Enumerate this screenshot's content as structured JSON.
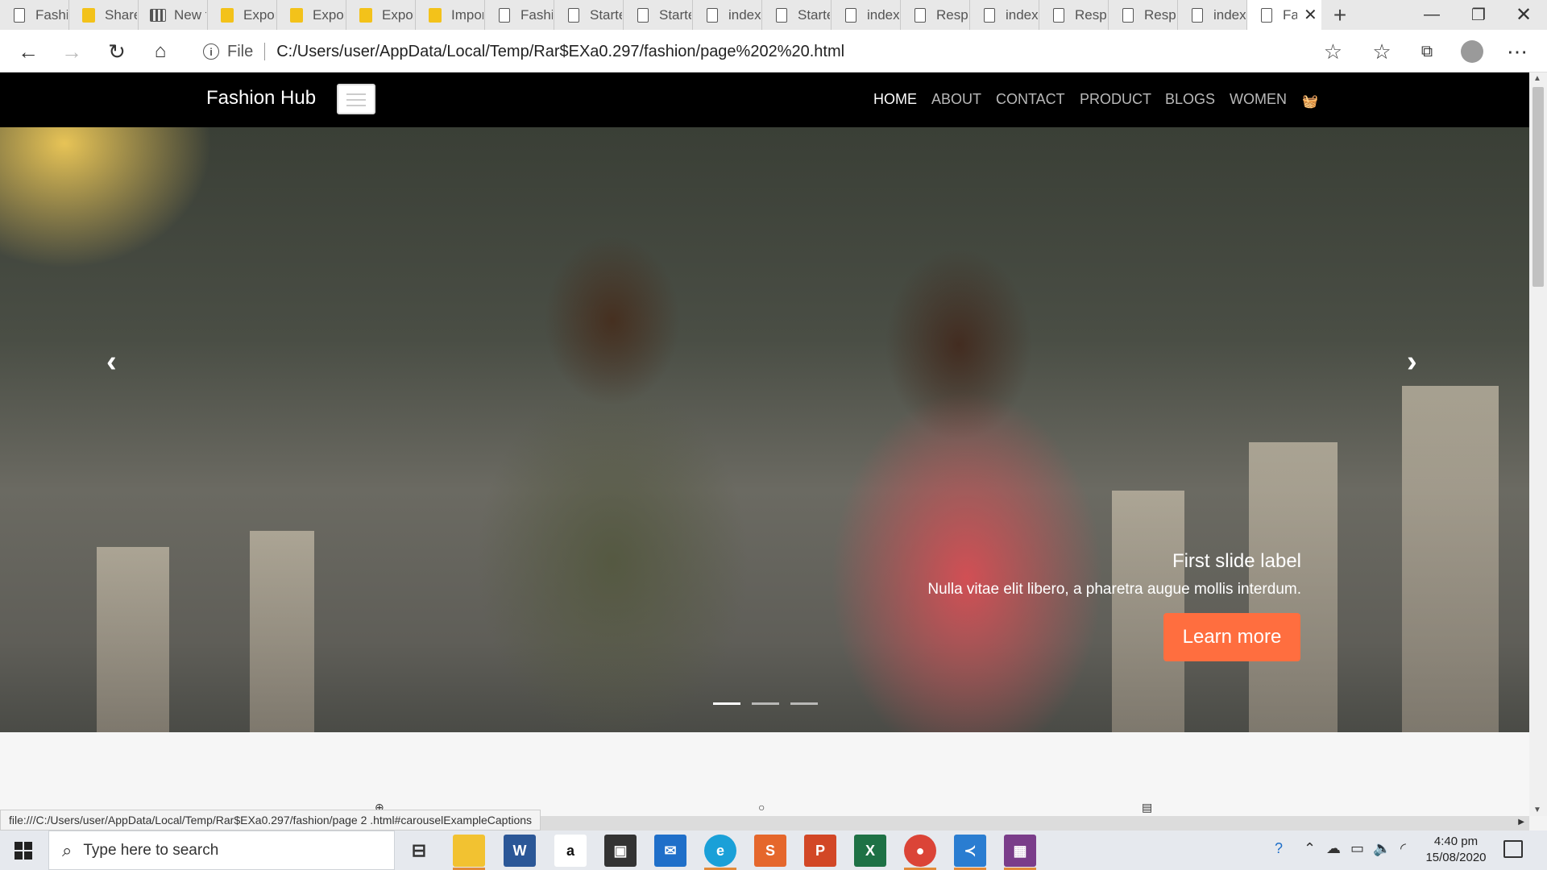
{
  "browser": {
    "tabs": [
      {
        "label": "Fashio",
        "icon": "page-icon"
      },
      {
        "label": "Share",
        "icon": "folder-icon"
      },
      {
        "label": "New t",
        "icon": "grid-icon"
      },
      {
        "label": "Expor",
        "icon": "folder-icon"
      },
      {
        "label": "Expor",
        "icon": "folder-icon"
      },
      {
        "label": "Expor",
        "icon": "folder-icon"
      },
      {
        "label": "Impor",
        "icon": "folder-icon"
      },
      {
        "label": "Fashio",
        "icon": "page-icon"
      },
      {
        "label": "Starte",
        "icon": "page-icon"
      },
      {
        "label": "Starte",
        "icon": "page-icon"
      },
      {
        "label": "index",
        "icon": "page-icon"
      },
      {
        "label": "Starte",
        "icon": "page-icon"
      },
      {
        "label": "index",
        "icon": "page-icon"
      },
      {
        "label": "Respo",
        "icon": "page-icon"
      },
      {
        "label": "index",
        "icon": "page-icon"
      },
      {
        "label": "Respo",
        "icon": "page-icon"
      },
      {
        "label": "Respo",
        "icon": "page-icon"
      },
      {
        "label": "index",
        "icon": "page-icon"
      }
    ],
    "active_tab": {
      "label": "Fa",
      "icon": "page-icon",
      "close": "✕"
    },
    "new_tab": "+",
    "address": {
      "scheme": "File",
      "url": "C:/Users/user/AppData/Local/Temp/Rar$EXa0.297/fashion/page%202%20.html"
    },
    "status_url": "file:///C:/Users/user/AppData/Local/Temp/Rar$EXa0.297/fashion/page 2 .html#carouselExampleCaptions"
  },
  "site": {
    "brand": "Fashion Hub",
    "menu": [
      "HOME",
      "ABOUT",
      "CONTACT",
      "PRODUCT",
      "BLOGS",
      "WOMEN"
    ],
    "active_menu": "HOME",
    "carousel": {
      "title": "First slide label",
      "text": "Nulla vitae elit libero, a pharetra augue mollis interdum.",
      "button": "Learn more",
      "prev": "‹",
      "next": "›",
      "slides": 3,
      "active_slide": 1
    },
    "accent_color": "#ff6e3f"
  },
  "taskbar": {
    "search_placeholder": "Type here to search",
    "time": "4:40 pm",
    "date": "15/08/2020"
  }
}
